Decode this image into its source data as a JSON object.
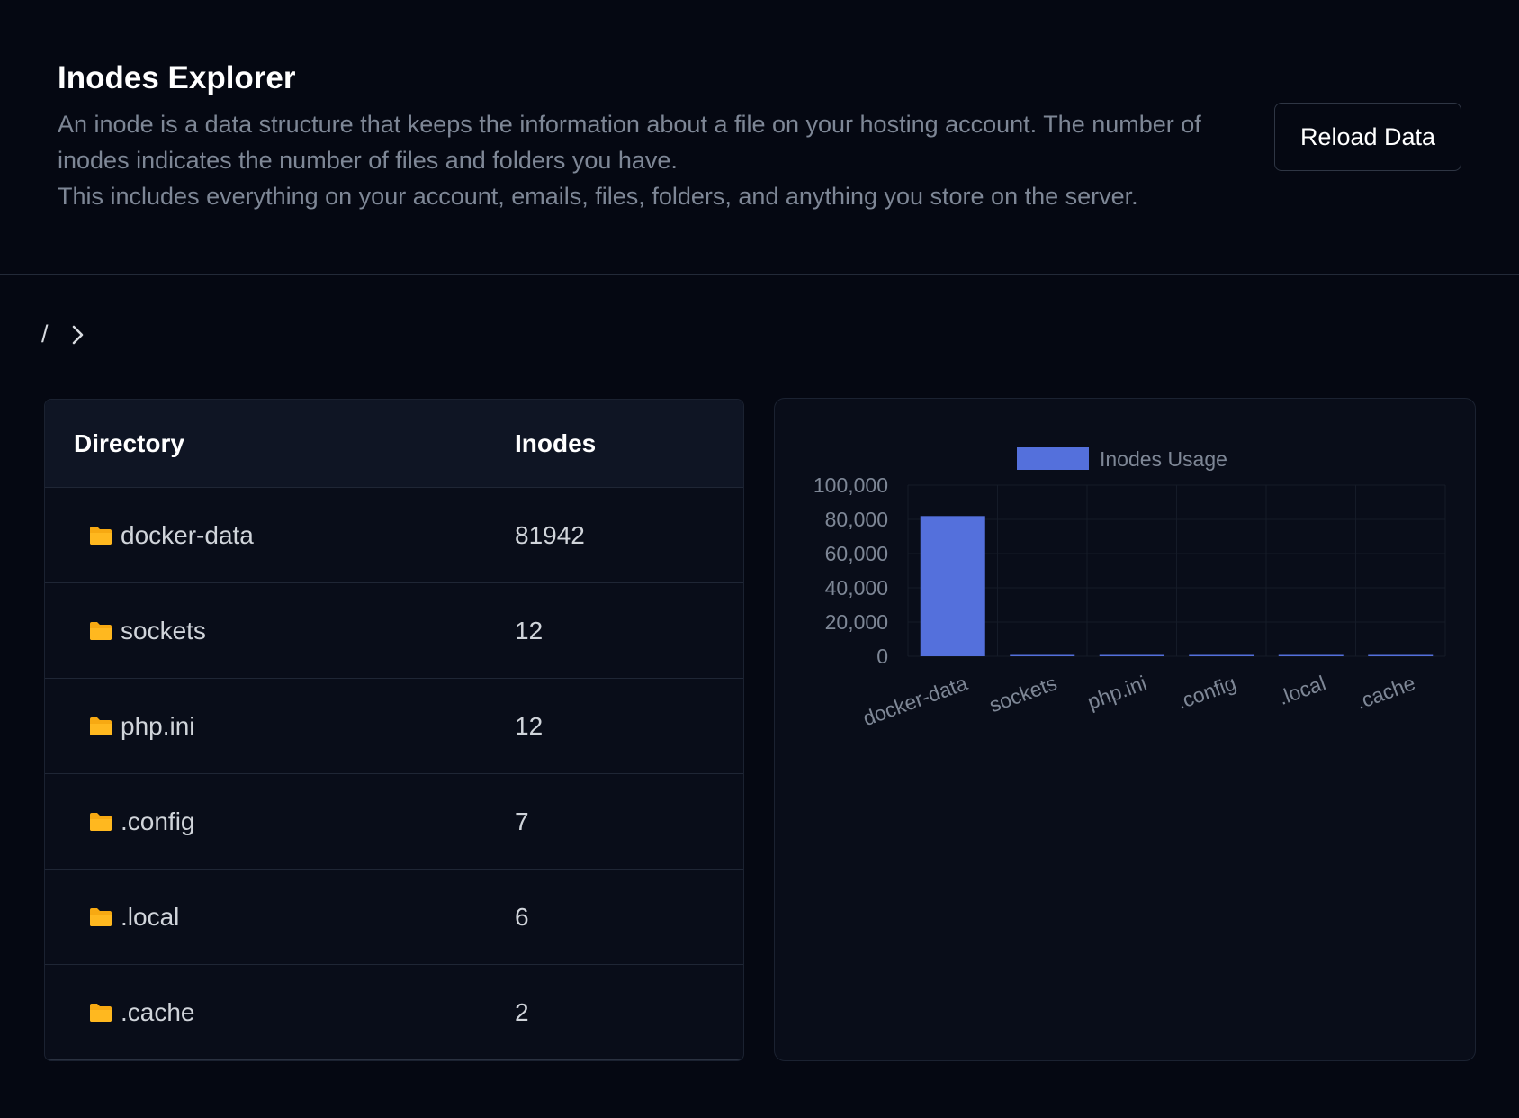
{
  "header": {
    "title": "Inodes Explorer",
    "description_line1": "An inode is a data structure that keeps the information about a file on your hosting account. The number of inodes indicates the number of files and folders you have.",
    "description_line2": "This includes everything on your account, emails, files, folders, and anything you store on the server.",
    "reload_label": "Reload Data"
  },
  "breadcrumb": {
    "root": "/"
  },
  "table": {
    "columns": [
      "Directory",
      "Inodes"
    ],
    "rows": [
      {
        "name": "docker-data",
        "inodes": "81942"
      },
      {
        "name": "sockets",
        "inodes": "12"
      },
      {
        "name": "php.ini",
        "inodes": "12"
      },
      {
        "name": ".config",
        "inodes": "7"
      },
      {
        "name": ".local",
        "inodes": "6"
      },
      {
        "name": ".cache",
        "inodes": "2"
      }
    ]
  },
  "colors": {
    "bar": "#5470dc",
    "folder": "#f7a912"
  },
  "chart_data": {
    "type": "bar",
    "categories": [
      "docker-data",
      "sockets",
      "php.ini",
      ".config",
      ".local",
      ".cache"
    ],
    "series": [
      {
        "name": "Inodes Usage",
        "values": [
          81942,
          12,
          12,
          7,
          6,
          2
        ]
      }
    ],
    "ylim": [
      0,
      100000
    ],
    "yticks": [
      "100,000",
      "80,000",
      "60,000",
      "40,000",
      "20,000",
      "0"
    ],
    "legend": "top",
    "grid": true
  }
}
